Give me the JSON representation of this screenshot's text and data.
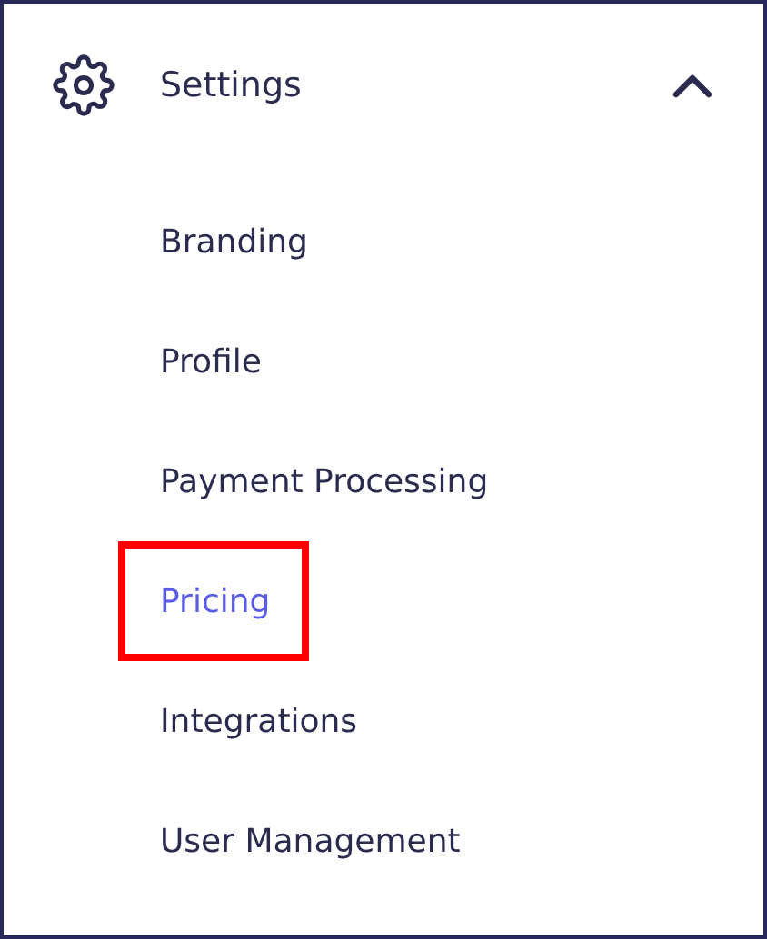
{
  "section": {
    "title": "Settings",
    "expanded": true
  },
  "items": [
    {
      "label": "Branding",
      "selected": false
    },
    {
      "label": "Profile",
      "selected": false
    },
    {
      "label": "Payment Processing",
      "selected": false
    },
    {
      "label": "Pricing",
      "selected": true
    },
    {
      "label": "Integrations",
      "selected": false
    },
    {
      "label": "User Management",
      "selected": false
    }
  ]
}
